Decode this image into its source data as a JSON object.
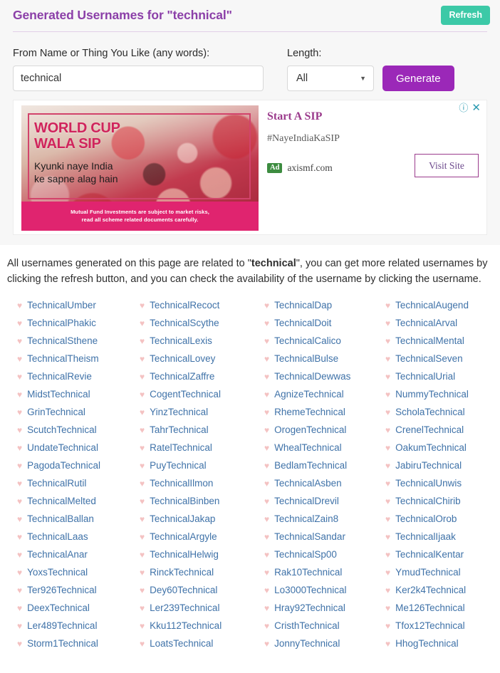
{
  "header": {
    "title": "Generated Usernames for \"technical\"",
    "refresh_label": "Refresh",
    "title_color": "#8b3fa8",
    "refresh_color": "#3cc9a7"
  },
  "form": {
    "name_label": "From Name or Thing You Like (any words):",
    "name_value": "technical",
    "name_placeholder": "",
    "length_label": "Length:",
    "length_value": "All",
    "length_options": [
      "All"
    ],
    "caret_icon": "chevron-down-icon",
    "generate_label": "Generate",
    "generate_color": "#9b28b8"
  },
  "ad": {
    "creative_headline": "WORLD CUP\nWALA SIP",
    "creative_headline_line1": "WORLD CUP",
    "creative_headline_line2": "WALA SIP",
    "creative_sub_line1": "Kyunki naye India",
    "creative_sub_line2": "ke sapne alag hain",
    "disclaimer_line1": "Mutual Fund Investments are subject to market risks,",
    "disclaimer_line2": "read all scheme related documents carefully.",
    "title": "Start A SIP",
    "description": "#NayeIndiaKaSIP",
    "badge": "Ad",
    "domain": "axismf.com",
    "cta_label": "Visit Site",
    "info_icon": "info-circle-icon",
    "close_icon": "close-icon"
  },
  "description": {
    "part1": "All usernames generated on this page are related to \"",
    "keyword": "technical",
    "part2": "\", you can get more related usernames by clicking the refresh button, and you can check the availability of the username by clicking the username."
  },
  "usernames": {
    "heart_icon": "heart-icon",
    "heart_color": "#f4c2c2",
    "link_color": "#3f72a8",
    "columns": [
      [
        "TechnicalUmber",
        "TechnicalPhakic",
        "TechnicalSthene",
        "TechnicalTheism",
        "TechnicalRevie",
        "MidstTechnical",
        "GrinTechnical",
        "ScutchTechnical",
        "UndateTechnical",
        "PagodaTechnical",
        "TechnicalRutil",
        "TechnicalMelted",
        "TechnicalBallan",
        "TechnicalLaas",
        "TechnicalAnar",
        "YoxsTechnical",
        "Ter926Technical",
        "DeexTechnical",
        "Ler489Technical",
        "Storm1Technical"
      ],
      [
        "TechnicalRecoct",
        "TechnicalScythe",
        "TechnicalLexis",
        "TechnicalLovey",
        "TechnicalZaffre",
        "CogentTechnical",
        "YinzTechnical",
        "TahrTechnical",
        "RatelTechnical",
        "PuyTechnical",
        "TechnicalIlmon",
        "TechnicalBinben",
        "TechnicalJakap",
        "TechnicalArgyle",
        "TechnicalHelwig",
        "RinckTechnical",
        "Dey60Technical",
        "Ler239Technical",
        "Kku112Technical",
        "LoatsTechnical"
      ],
      [
        "TechnicalDap",
        "TechnicalDoit",
        "TechnicalCalico",
        "TechnicalBulse",
        "TechnicalDewwas",
        "AgnizeTechnical",
        "RhemeTechnical",
        "OrogenTechnical",
        "WhealTechnical",
        "BedlamTechnical",
        "TechnicalAsben",
        "TechnicalDrevil",
        "TechnicalZain8",
        "TechnicalSandar",
        "TechnicalSp00",
        "Rak10Technical",
        "Lo3000Technical",
        "Hray92Technical",
        "CristhTechnical",
        "JonnyTechnical"
      ],
      [
        "TechnicalAugend",
        "TechnicalArval",
        "TechnicalMental",
        "TechnicalSeven",
        "TechnicalUrial",
        "NummyTechnical",
        "ScholaTechnical",
        "CrenelTechnical",
        "OakumTechnical",
        "JabiruTechnical",
        "TechnicalUnwis",
        "TechnicalChirib",
        "TechnicalOrob",
        "TechnicalIjaak",
        "TechnicalKentar",
        "YmudTechnical",
        "Ker2k4Technical",
        "Me126Technical",
        "Tfox12Technical",
        "HhogTechnical"
      ]
    ]
  }
}
